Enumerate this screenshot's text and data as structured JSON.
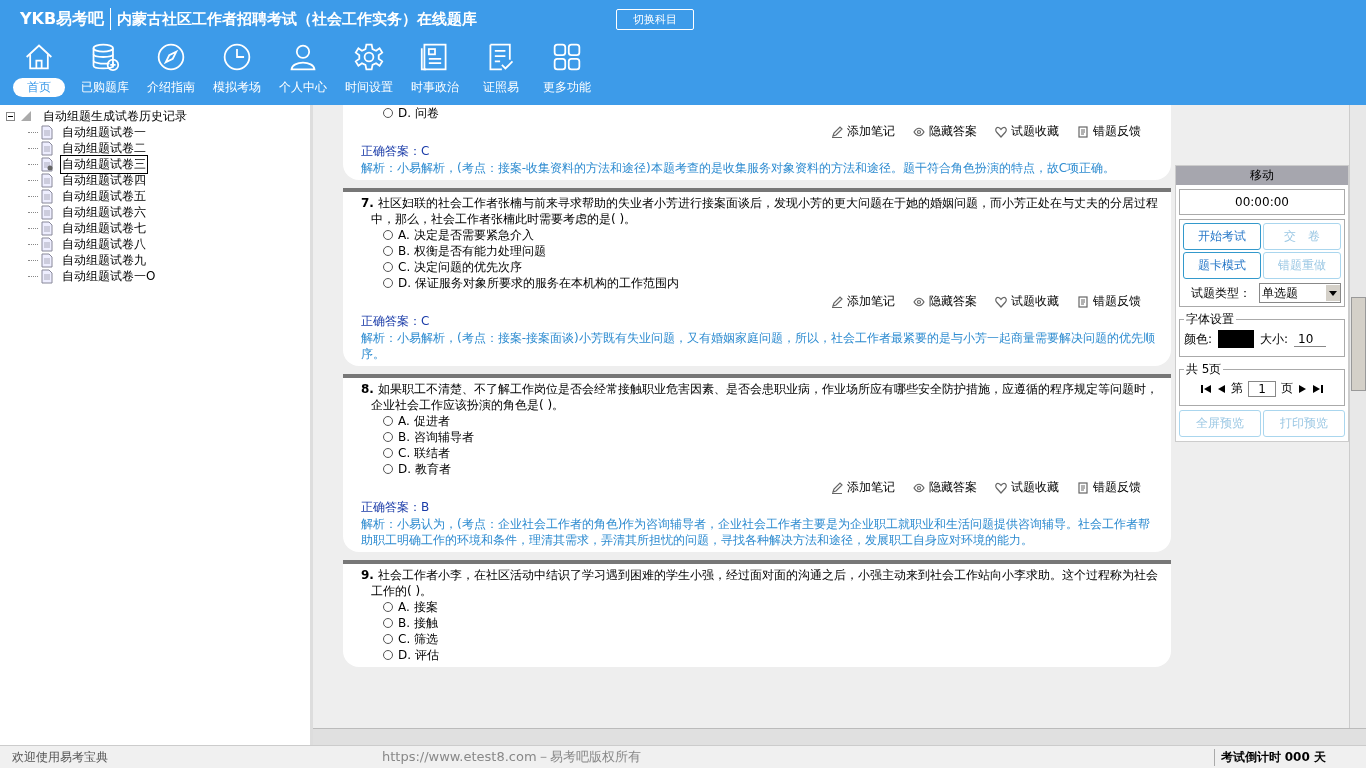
{
  "header": {
    "logo": "YKB易考吧",
    "title": "内蒙古社区工作者招聘考试（社会工作实务）在线题库",
    "switch_button": "切换科目"
  },
  "nav": [
    {
      "label": "首页",
      "selected": true
    },
    {
      "label": "已购题库",
      "selected": false
    },
    {
      "label": "介绍指南",
      "selected": false
    },
    {
      "label": "模拟考场",
      "selected": false
    },
    {
      "label": "个人中心",
      "selected": false
    },
    {
      "label": "时间设置",
      "selected": false
    },
    {
      "label": "时事政治",
      "selected": false
    },
    {
      "label": "证照易",
      "selected": false
    },
    {
      "label": "更多功能",
      "selected": false
    }
  ],
  "tree": {
    "label": "自动组题生成试卷历史记录",
    "expanded": true,
    "children": [
      {
        "label": "自动组题试卷一",
        "selected": false
      },
      {
        "label": "自动组题试卷二",
        "selected": false
      },
      {
        "label": "自动组题试卷三",
        "selected": true
      },
      {
        "label": "自动组题试卷四",
        "selected": false
      },
      {
        "label": "自动组题试卷五",
        "selected": false
      },
      {
        "label": "自动组题试卷六",
        "selected": false
      },
      {
        "label": "自动组题试卷七",
        "selected": false
      },
      {
        "label": "自动组题试卷八",
        "selected": false
      },
      {
        "label": "自动组题试卷九",
        "selected": false
      },
      {
        "label": "自动组题试卷一O",
        "selected": false
      }
    ]
  },
  "questions": [
    {
      "options": [
        {
          "text": "D. 问卷",
          "selected": false
        }
      ],
      "actions": [
        "添加笔记",
        "隐藏答案",
        "试题收藏",
        "错题反馈"
      ],
      "answer_label": "正确答案：",
      "answer": "C",
      "analysis": "解析：小易解析，(考点：接案-收集资料的方法和途径)本题考查的是收集服务对象资料的方法和途径。题干符合角色扮演的特点，故C项正确。"
    },
    {
      "number": "7.",
      "stem": "社区妇联的社会工作者张楠与前来寻求帮助的失业者小芳进行接案面谈后，发现小芳的更大问题在于她的婚姻问题，而小芳正处在与丈夫的分居过程中，那么，社会工作者张楠此时需要考虑的是( )。",
      "options": [
        {
          "text": "A. 决定是否需要紧急介入",
          "selected": false
        },
        {
          "text": "B. 权衡是否有能力处理问题",
          "selected": false
        },
        {
          "text": "C. 决定问题的优先次序",
          "selected": false
        },
        {
          "text": "D. 保证服务对象所要求的服务在本机构的工作范围内",
          "selected": false
        }
      ],
      "actions": [
        "添加笔记",
        "隐藏答案",
        "试题收藏",
        "错题反馈"
      ],
      "answer_label": "正确答案：",
      "answer": "C",
      "analysis": "解析：小易解析，(考点：接案-接案面谈)小芳既有失业问题，又有婚姻家庭问题，所以，社会工作者最紧要的是与小芳一起商量需要解决问题的优先顺序。"
    },
    {
      "number": "8.",
      "stem": "如果职工不清楚、不了解工作岗位是否会经常接触职业危害因素、是否会患职业病，作业场所应有哪些安全防护措施，应遵循的程序规定等问题时，企业社会工作应该扮演的角色是( )。",
      "options": [
        {
          "text": "A. 促进者",
          "selected": false
        },
        {
          "text": "B. 咨询辅导者",
          "selected": false
        },
        {
          "text": "C. 联结者",
          "selected": false
        },
        {
          "text": "D. 教育者",
          "selected": false
        }
      ],
      "actions": [
        "添加笔记",
        "隐藏答案",
        "试题收藏",
        "错题反馈"
      ],
      "answer_label": "正确答案：",
      "answer": "B",
      "analysis": "解析：小易认为，(考点：企业社会工作者的角色)作为咨询辅导者，企业社会工作者主要是为企业职工就职业和生活问题提供咨询辅导。社会工作者帮助职工明确工作的环境和条件，理清其需求，弄清其所担忧的问题，寻找各种解决方法和途径，发展职工自身应对环境的能力。"
    },
    {
      "number": "9.",
      "stem": "社会工作者小李，在社区活动中结识了学习遇到困难的学生小强，经过面对面的沟通之后，小强主动来到社会工作站向小李求助。这个过程称为社会工作的( )。",
      "options": [
        {
          "text": "A. 接案",
          "selected": false
        },
        {
          "text": "B. 接触",
          "selected": false
        },
        {
          "text": "C. 筛选",
          "selected": false
        },
        {
          "text": "D. 评估",
          "selected": false
        }
      ]
    }
  ],
  "panel": {
    "title": "移动",
    "timer": "00:00:00",
    "buttons": [
      {
        "label": "开始考试",
        "disabled": false
      },
      {
        "label": "交　卷",
        "disabled": true
      },
      {
        "label": "题卡模式",
        "disabled": false
      },
      {
        "label": "错题重做",
        "disabled": true
      }
    ],
    "type_label": "试题类型：",
    "type_value": "单选题",
    "font_group": "字体设置",
    "color_label": "颜色:",
    "size_label": "大小:",
    "size_value": "10",
    "page_group": "共 5页",
    "page_prefix": "第",
    "page_value": "1",
    "page_suffix": "页",
    "bottom_buttons": [
      {
        "label": "全屏预览",
        "disabled": true
      },
      {
        "label": "打印预览",
        "disabled": true
      }
    ]
  },
  "status_bar": {
    "welcome": "欢迎使用易考宝典",
    "copyright": "https://www.etest8.com－易考吧版权所有",
    "countdown": "考试倒计时 000 天"
  }
}
